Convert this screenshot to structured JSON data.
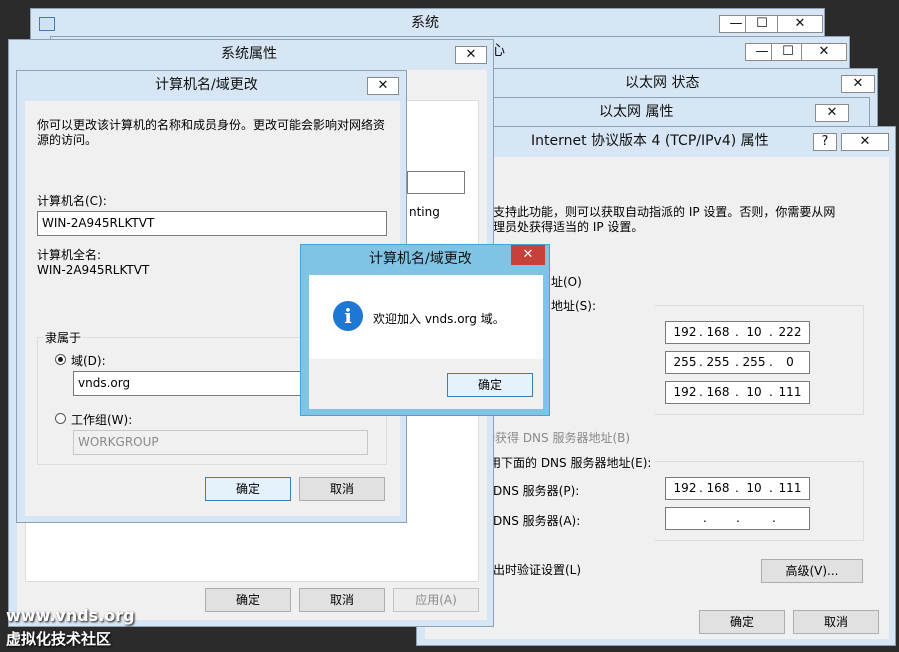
{
  "system_window": {
    "title": "系统",
    "minimize": "—",
    "maximize": "☐",
    "close": "✕"
  },
  "control_center": {
    "title_partial": "心",
    "minimize": "—",
    "maximize": "☐",
    "close": "✕"
  },
  "eth_status": {
    "title": "以太网 状态",
    "close": "✕"
  },
  "eth_props": {
    "title": "以太网 属性",
    "close": "✕"
  },
  "ipv4": {
    "title": "Internet 协议版本 4 (TCP/IPv4) 属性",
    "help": "?",
    "close": "✕",
    "desc_line1": "支持此功能，则可以获取自动指派的 IP 设置。否则，你需要从网",
    "desc_line2": "理员处获得适当的 IP 设置。",
    "auto_ip_partial": "址(O)",
    "use_ip_partial": "地址(S):",
    "ip_address": [
      "192",
      "168",
      "10",
      "222"
    ],
    "subnet_mask": [
      "255",
      "255",
      "255",
      "0"
    ],
    "gateway": [
      "192",
      "168",
      "10",
      "111"
    ],
    "auto_dns_partial": "动获得 DNS 服务器地址(B)",
    "use_dns_partial": "用下面的 DNS 服务器地址(E):",
    "preferred_dns_label": "DNS 服务器(P):",
    "preferred_dns": [
      "192",
      "168",
      "10",
      "111"
    ],
    "alternate_dns_label": "DNS 服务器(A):",
    "alternate_dns": [
      "",
      "",
      "",
      ""
    ],
    "validate_partial": "出时验证设置(L)",
    "advanced": "高级(V)...",
    "ok": "确定",
    "cancel": "取消"
  },
  "sysprops": {
    "title": "系统属性",
    "close": "✕",
    "partial_text": "nting",
    "ok": "确定",
    "cancel": "取消",
    "apply": "应用(A)"
  },
  "name_change": {
    "title": "计算机名/域更改",
    "close": "✕",
    "desc_line1": "你可以更改该计算机的名称和成员身份。更改可能会影响对网络资",
    "desc_line2": "源的访问。",
    "computer_name_label": "计算机名(C):",
    "computer_name_value": "WIN-2A945RLKTVT",
    "full_name_label": "计算机全名:",
    "full_name_value": "WIN-2A945RLKTVT",
    "member_of": "隶属于",
    "domain_label": "域(D):",
    "domain_value": "vnds.org",
    "workgroup_label": "工作组(W):",
    "workgroup_value": "WORKGROUP",
    "ok": "确定",
    "cancel": "取消"
  },
  "welcome": {
    "title": "计算机名/域更改",
    "close": "✕",
    "info_icon": "i",
    "message": "欢迎加入 vnds.org 域。",
    "ok": "确定"
  },
  "watermark": {
    "line1": "www.vnds.org",
    "line2": "虚拟化技术社区"
  },
  "colors": {
    "frame": "#d7e6f4",
    "active_frame": "#7fc4e3",
    "close_red": "#c7403a",
    "info_blue": "#1e77d3"
  }
}
